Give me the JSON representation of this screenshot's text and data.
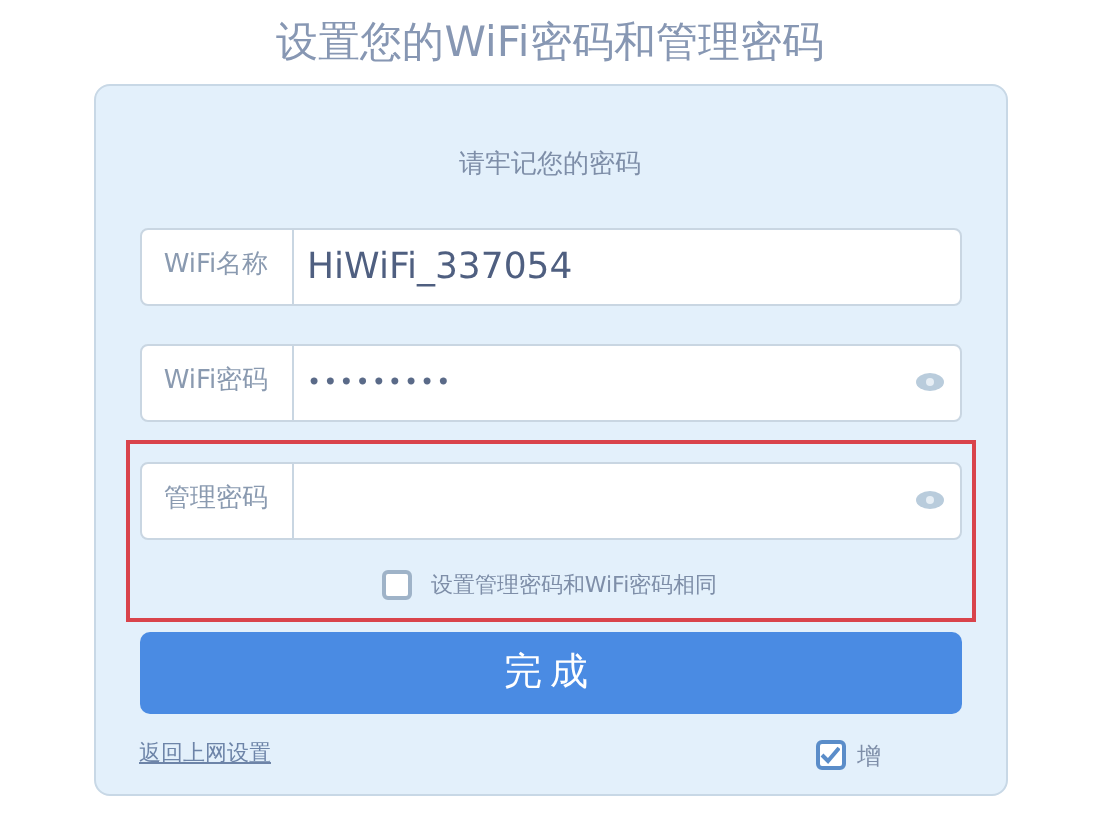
{
  "title": "设置您的WiFi密码和管理密码",
  "subtitle": "请牢记您的密码",
  "fields": [
    {
      "label": "WiFi名称",
      "value": "HiWiFi_337054",
      "kind": "text"
    },
    {
      "label": "WiFi密码",
      "value": "•••••••••",
      "kind": "password"
    },
    {
      "label": "管理密码",
      "kind": "password",
      "highlighted": true
    }
  ],
  "same_password": {
    "label": "设置管理密码和WiFi密码相同",
    "checked": false
  },
  "submit": "完成",
  "back_link": "返回上网设置",
  "extra_option": {
    "label": "增",
    "checked": true
  }
}
